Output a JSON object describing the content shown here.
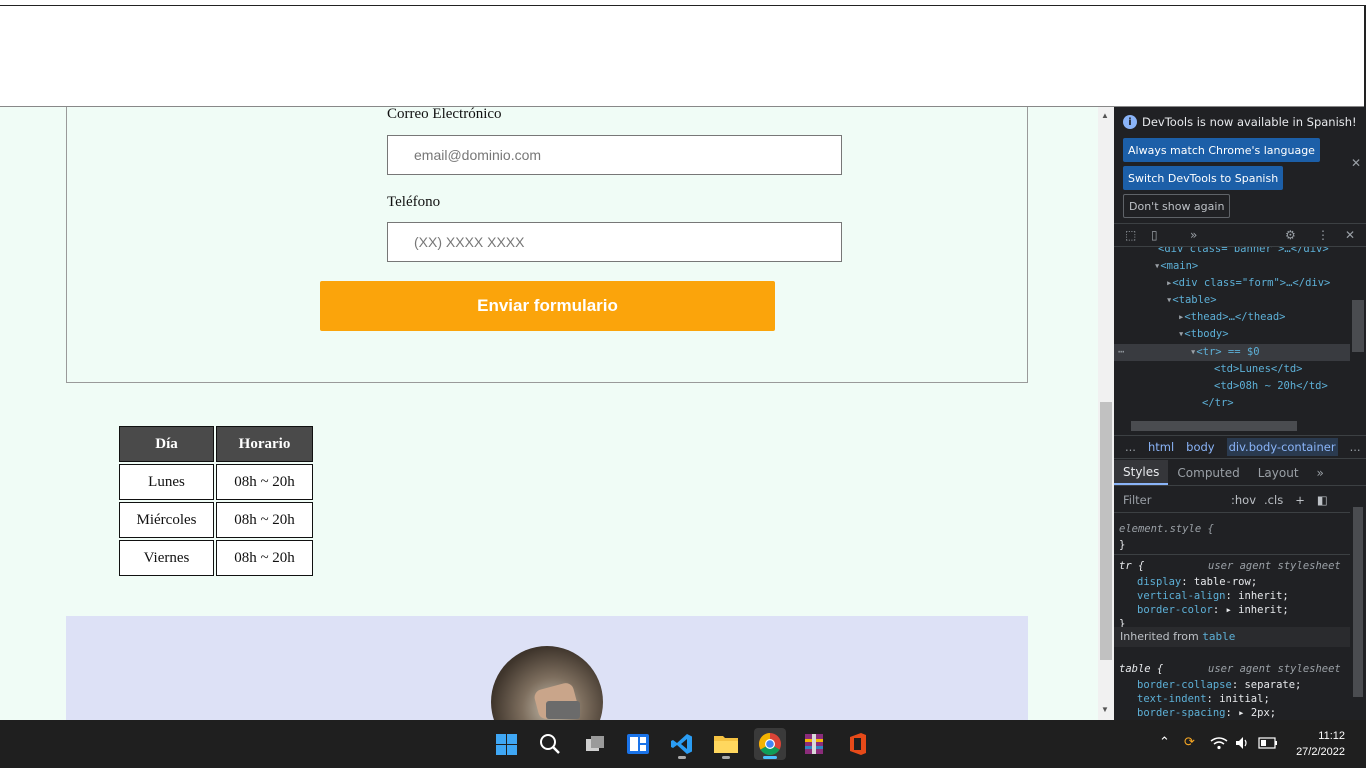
{
  "form": {
    "email_label": "Correo Electrónico",
    "email_placeholder": "email@dominio.com",
    "phone_label": "Teléfono",
    "phone_placeholder": "(XX) XXXX XXXX",
    "submit_label": "Enviar formulario"
  },
  "schedule": {
    "headers": [
      "Día",
      "Horario"
    ],
    "rows": [
      [
        "Lunes",
        "08h ~ 20h"
      ],
      [
        "Miércoles",
        "08h ~ 20h"
      ],
      [
        "Viernes",
        "08h ~ 20h"
      ]
    ]
  },
  "devtools": {
    "banner_text": "DevTools is now available in Spanish!",
    "btn_match": "Always match Chrome's language",
    "btn_switch": "Switch DevTools to Spanish",
    "btn_dont_show": "Don't show again",
    "elements": {
      "l0": "<div class=\"banner\">…</div>",
      "l1": "<main>",
      "l2_tag": "<div class=\"form\">…</div>",
      "l3": "<table>",
      "l4": "<thead>…</thead>",
      "l5": "<tbody>",
      "l6": "<tr> == $0",
      "l7": "<td>Lunes</td>",
      "l8": "<td>08h ~ 20h</td>",
      "l9": "</tr>"
    },
    "breadcrumbs": [
      "...",
      "html",
      "body",
      "div.body-container",
      "..."
    ],
    "tabs": [
      "Styles",
      "Computed",
      "Layout",
      "»"
    ],
    "filter_placeholder": "Filter",
    "filter_hov": ":hov",
    "filter_cls": ".cls",
    "styles": {
      "element_style": "element.style {",
      "close_brace": "}",
      "tr_selector": "tr {",
      "ua_label": "user agent stylesheet",
      "tr_props": [
        {
          "prop": "display",
          "value": "table-row;"
        },
        {
          "prop": "vertical-align",
          "value": "inherit;"
        },
        {
          "prop": "border-color",
          "value": "▸ inherit;"
        }
      ],
      "inherited_from": "Inherited from",
      "inherited_el": "table",
      "table_selector": "table {",
      "table_props": [
        {
          "prop": "border-collapse",
          "value": "separate;"
        },
        {
          "prop": "text-indent",
          "value": "initial;"
        },
        {
          "prop": "border-spacing",
          "value": "▸ 2px;"
        }
      ]
    }
  },
  "taskbar": {
    "time": "11:12",
    "date": "27/2/2022",
    "colors": {
      "accent": "#4cc2ff",
      "submit": "#fba40b"
    }
  }
}
